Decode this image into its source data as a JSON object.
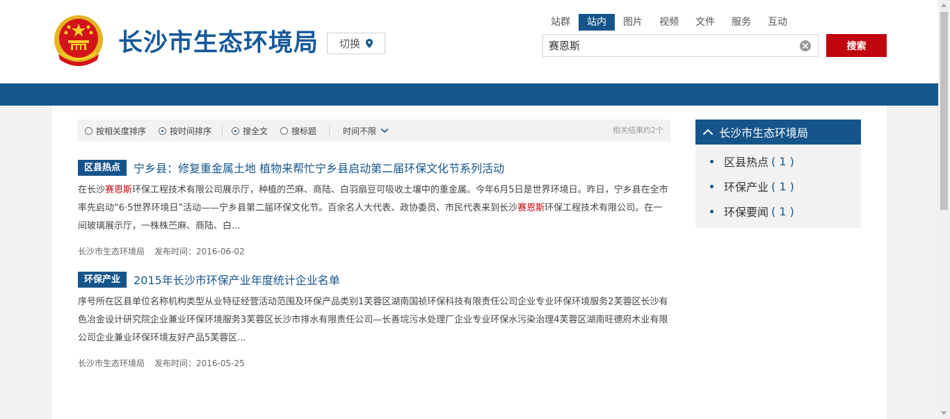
{
  "header": {
    "site_title": "长沙市生态环境局",
    "switch_label": "切换",
    "scope_tabs": [
      "站群",
      "站内",
      "图片",
      "视频",
      "文件",
      "服务",
      "互动"
    ],
    "active_scope": "站内",
    "search_value": "赛恩斯",
    "search_button": "搜索",
    "brand_color": "#16558a",
    "accent_color": "#c1050f"
  },
  "filters": {
    "sort_relevance": "按相关度排序",
    "sort_time": "按时间排序",
    "search_fulltext": "搜全文",
    "search_title": "搜标题",
    "time_range": "时间不限",
    "result_count": "相关结果约2个"
  },
  "results": [
    {
      "tag": "区县热点",
      "title": "宁乡县：修复重金属土地 植物来帮忙宁乡县启动第二届环保文化节系列活动",
      "abstract_parts": [
        "在长沙",
        "赛恩斯",
        "环保工程技术有限公司展示厅，种植的苎麻、商陆、白羽扇豆可吸收土壤中的重金属。今年6月5日是世界环境日。昨日，宁乡县在全市率先启动“6·5世界环境日”活动——宁乡县第二届环保文化节。百余名人大代表、政协委员、市民代表来到长沙",
        "赛恩斯",
        "环保工程技术有限公司。在一间玻璃展示厅，一株株苎麻、商陆、白..."
      ],
      "source": "长沙市生态环境局",
      "date": "发布时间：2016-06-02"
    },
    {
      "tag": "环保产业",
      "title": "2015年长沙市环保产业年度统计企业名单",
      "abstract": "序号所在区县单位名称机构类型从业特征经营活动范围及环保产品类别1芙蓉区湖南国祯环保科技有限责任公司企业专业环保环境服务2芙蓉区长沙有色冶金设计研究院企业兼业环保环境服务3芙蓉区长沙市排水有限责任公司—长善垸污水处理厂企业专业环保水污染治理4芙蓉区湖南旺德府木业有限公司企业兼业环保环境友好产品5芙蓉区...",
      "source": "长沙市生态环境局",
      "date": "发布时间：2016-05-25"
    }
  ],
  "sidebar": {
    "title": "长沙市生态环境局",
    "items": [
      {
        "label": "区县热点",
        "count": "( 1 )"
      },
      {
        "label": "环保产业",
        "count": "( 1 )"
      },
      {
        "label": "环保要闻",
        "count": "( 1 )"
      }
    ]
  }
}
